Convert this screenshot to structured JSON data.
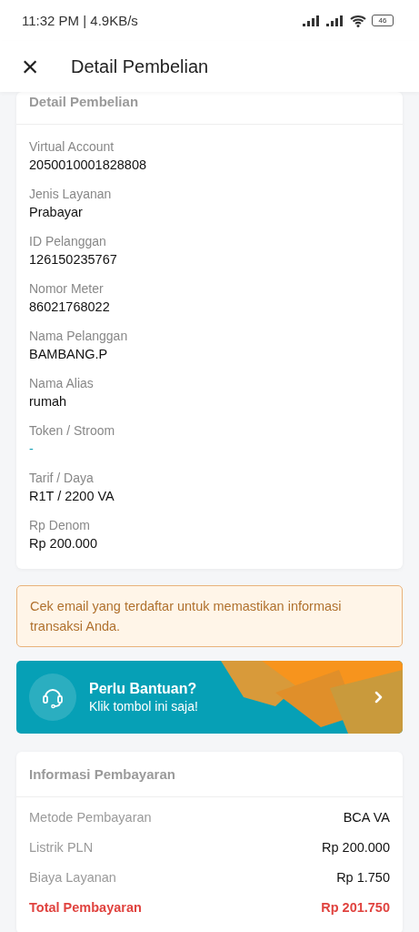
{
  "status_bar": {
    "time_speed": "11:32 PM | 4.9KB/s",
    "battery": "46"
  },
  "app_bar": {
    "close": "×",
    "title": "Detail Pembelian"
  },
  "detail_card": {
    "title": "Detail Pembelian",
    "fields": [
      {
        "label": "Virtual Account",
        "value": "2050010001828808",
        "kind": "plain"
      },
      {
        "label": "Jenis Layanan",
        "value": "Prabayar",
        "kind": "plain"
      },
      {
        "label": "ID Pelanggan",
        "value": "126150235767",
        "kind": "plain"
      },
      {
        "label": "Nomor Meter",
        "value": "86021768022",
        "kind": "plain"
      },
      {
        "label": "Nama Pelanggan",
        "value": "BAMBANG.P",
        "kind": "plain"
      },
      {
        "label": "Nama Alias",
        "value": "rumah",
        "kind": "plain"
      },
      {
        "label": "Token / Stroom",
        "value": "-",
        "kind": "accent"
      },
      {
        "label": "Tarif / Daya",
        "value": "R1T / 2200 VA",
        "kind": "plain"
      },
      {
        "label": "Rp Denom",
        "value": "Rp 200.000",
        "kind": "plain"
      }
    ]
  },
  "notice": {
    "text": "Cek email yang terdaftar untuk memastikan informasi transaksi Anda."
  },
  "help_banner": {
    "title": "Perlu Bantuan?",
    "subtitle": "Klik tombol ini saja!"
  },
  "payment_card": {
    "title": "Informasi Pembayaran",
    "rows": [
      {
        "label": "Metode Pembayaran",
        "value": "BCA VA",
        "kind": "plain"
      },
      {
        "label": "Listrik PLN",
        "value": "Rp 200.000",
        "kind": "plain"
      },
      {
        "label": "Biaya Layanan",
        "value": "Rp 1.750",
        "kind": "plain"
      },
      {
        "label": "Total Pembayaran",
        "value": "Rp 201.750",
        "kind": "total"
      }
    ]
  }
}
